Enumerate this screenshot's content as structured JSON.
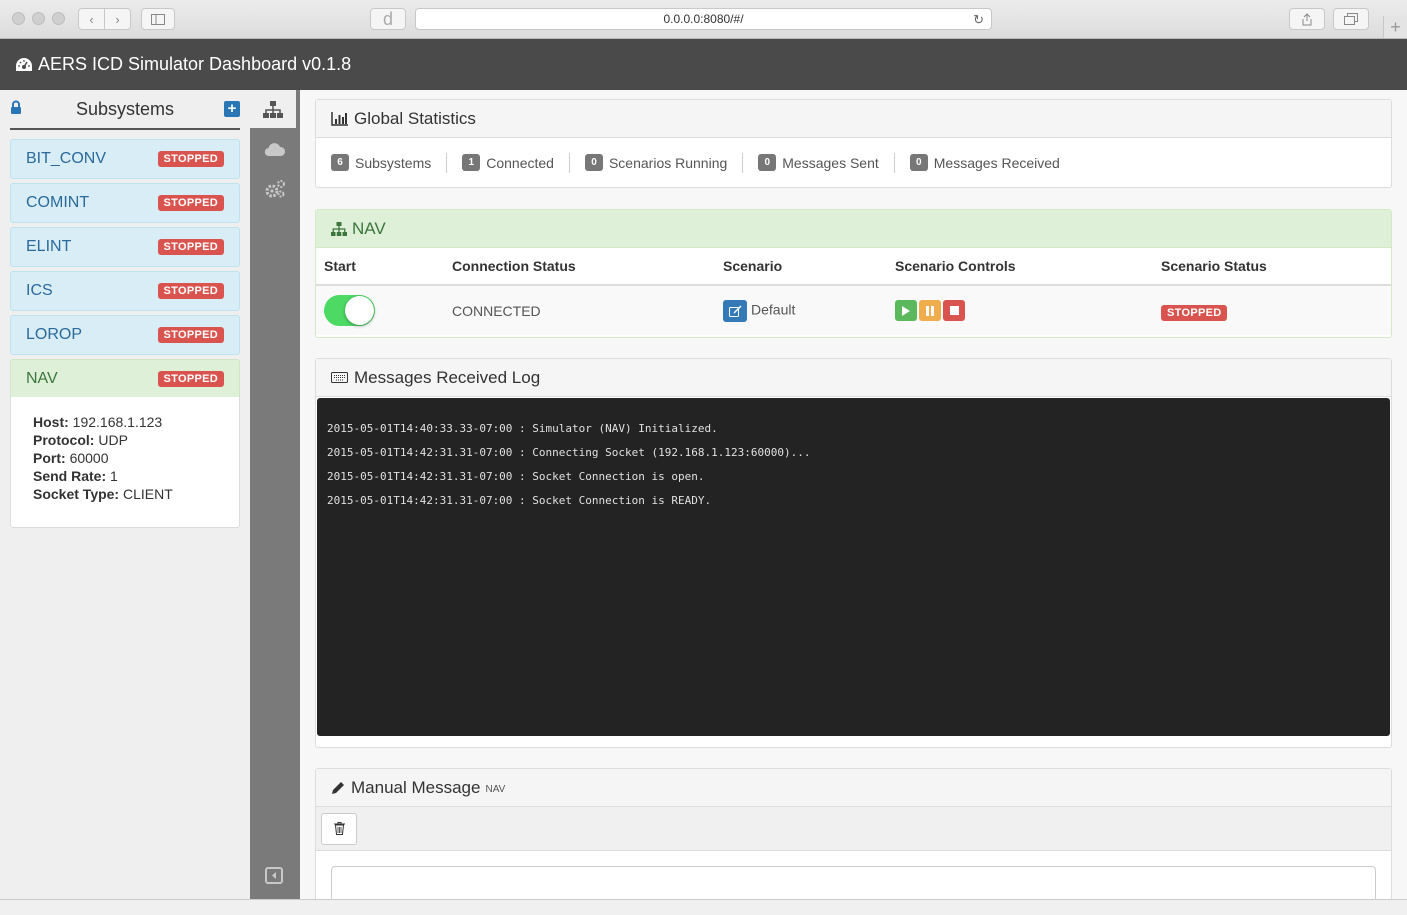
{
  "browser": {
    "url": "0.0.0.0:8080/#/"
  },
  "app": {
    "title": "AERS ICD Simulator Dashboard v0.1.8"
  },
  "sidebar": {
    "title": "Subsystems",
    "items": [
      {
        "name": "BIT_CONV",
        "status": "STOPPED"
      },
      {
        "name": "COMINT",
        "status": "STOPPED"
      },
      {
        "name": "ELINT",
        "status": "STOPPED"
      },
      {
        "name": "ICS",
        "status": "STOPPED"
      },
      {
        "name": "LOROP",
        "status": "STOPPED"
      },
      {
        "name": "NAV",
        "status": "STOPPED"
      }
    ],
    "details": {
      "host_label": "Host:",
      "host": "192.168.1.123",
      "protocol_label": "Protocol:",
      "protocol": "UDP",
      "port_label": "Port:",
      "port": "60000",
      "rate_label": "Send Rate:",
      "rate": "1",
      "socket_label": "Socket Type:",
      "socket": "CLIENT"
    }
  },
  "stats": {
    "title": "Global Statistics",
    "items": [
      {
        "count": "6",
        "label": "Subsystems"
      },
      {
        "count": "1",
        "label": "Connected"
      },
      {
        "count": "0",
        "label": "Scenarios Running"
      },
      {
        "count": "0",
        "label": "Messages Sent"
      },
      {
        "count": "0",
        "label": "Messages Received"
      }
    ]
  },
  "nav_panel": {
    "title": "NAV",
    "headers": [
      "Start",
      "Connection Status",
      "Scenario",
      "Scenario Controls",
      "Scenario Status"
    ],
    "toggle_on": true,
    "connection_status": "CONNECTED",
    "scenario": "Default",
    "scenario_status": "STOPPED"
  },
  "log": {
    "title": "Messages Received Log",
    "lines": [
      "2015-05-01T14:40:33.33-07:00 : Simulator (NAV) Initialized.",
      "2015-05-01T14:42:31.31-07:00 : Connecting Socket (192.168.1.123:60000)...",
      "2015-05-01T14:42:31.31-07:00 : Socket Connection is open.",
      "2015-05-01T14:42:31.31-07:00 : Socket Connection is READY."
    ]
  },
  "manual": {
    "title": "Manual Message",
    "subtitle": "NAV"
  },
  "colors": {
    "header_bg": "#4a4a4a",
    "stopped": "#d9534f",
    "connected_toggle": "#4cd964",
    "play": "#5cb85c",
    "pause": "#f0ad4e",
    "stop": "#d9534f"
  }
}
